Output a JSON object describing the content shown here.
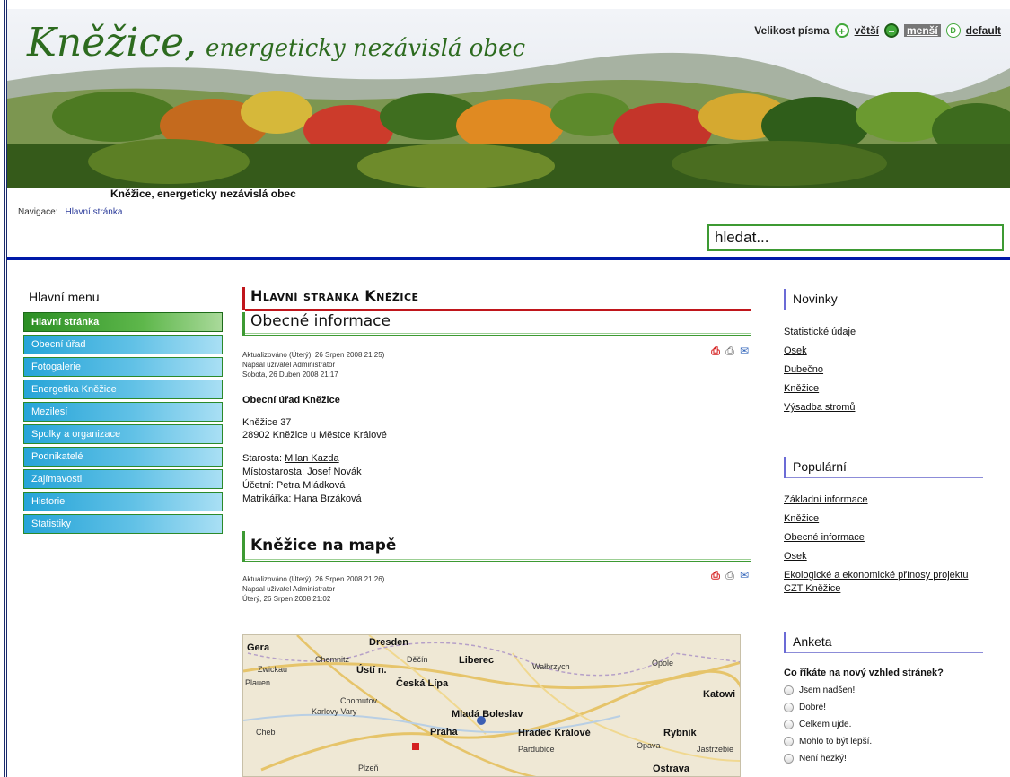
{
  "header": {
    "title_main": "Kněžice,",
    "title_rest": "energeticky nezávislá obec",
    "subtitle": "Kněžice, energeticky nezávislá obec"
  },
  "font_size": {
    "label": "Velikost písma",
    "bigger": "větší",
    "smaller": "menší",
    "default": "default"
  },
  "breadcrumb": {
    "label": "Navigace:",
    "home": "Hlavní stránka"
  },
  "search": {
    "value": "hledat..."
  },
  "menu": {
    "title": "Hlavní menu",
    "items": [
      "Hlavní stránka",
      "Obecní úřad",
      "Fotogalerie",
      "Energetika Kněžice",
      "Mezilesí",
      "Spolky a organizace",
      "Podnikatelé",
      "Zajímavosti",
      "Historie",
      "Statistiky"
    ]
  },
  "main": {
    "page_title": "Hlavní stránka Kněžice",
    "article1": {
      "title": "Obecné informace",
      "meta_updated": "Aktualizováno (Úterý), 26 Srpen 2008 21:25)",
      "meta_author": "Napsal uživatel Administrator",
      "meta_date": "Sobota, 26 Duben 2008 21:17",
      "office_title": "Obecní úřad Kněžice",
      "address_line1": "Kněžice 37",
      "address_line2": "28902 Kněžice u Městce Králové",
      "mayor_label": "Starosta:",
      "mayor_name": "Milan Kazda",
      "deputy_label": "Místostarosta:",
      "deputy_name": "Josef Novák",
      "accountant": "Účetní: Petra Mládková",
      "registrar": "Matrikářka: Hana Brzáková"
    },
    "article2": {
      "title": "Kněžice na mapě",
      "meta_updated": "Aktualizováno (Úterý), 26 Srpen 2008 21:26)",
      "meta_author": "Napsal uživatel Administrator",
      "meta_date": "Úterý, 26 Srpen 2008 21:02"
    }
  },
  "map": {
    "labels": [
      "Dresden",
      "Gera",
      "Chemnitz",
      "Zwickau",
      "Ústí n.",
      "Děčín",
      "Liberec",
      "Wałbrzych",
      "Opole",
      "Plauen",
      "Česká Lípa",
      "Chomutov",
      "Mladá Boleslav",
      "Karlovy Vary",
      "Cheb",
      "Praha",
      "Hradec Králové",
      "Pardubice",
      "Rybník",
      "Opava",
      "Plzeň",
      "Ostrava",
      "Katowi",
      "Jastrzebie"
    ]
  },
  "news": {
    "title": "Novinky",
    "links": [
      "Statistické údaje",
      "Osek",
      "Dubečno",
      "Kněžice",
      "Výsadba stromů"
    ]
  },
  "popular": {
    "title": "Populární",
    "links": [
      "Základní informace",
      "Kněžice",
      "Obecné informace",
      "Osek",
      "Ekologické a ekonomické přínosy projektu CZT Kněžice"
    ]
  },
  "poll": {
    "title": "Anketa",
    "question": "Co říkáte na nový vzhled stránek?",
    "options": [
      "Jsem nadšen!",
      "Dobré!",
      "Celkem ujde.",
      "Mohlo to být lepší.",
      "Není hezký!"
    ]
  }
}
